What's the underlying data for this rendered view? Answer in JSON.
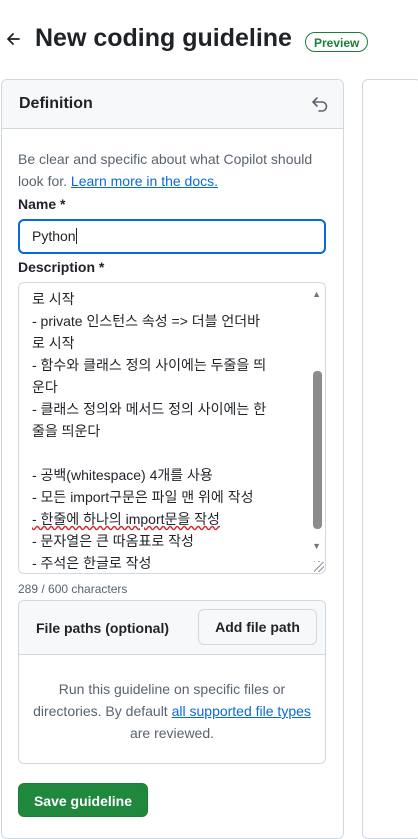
{
  "header": {
    "title": "New coding guideline",
    "badge": "Preview"
  },
  "definition": {
    "title": "Definition",
    "intro_text": "Be clear and specific about what Copilot should look for. ",
    "intro_link": "Learn more in the docs.",
    "name_label": "Name *",
    "name_value": "Python",
    "description_label": "Description *",
    "description_lines": [
      "로 시작",
      "- private 인스턴스 속성 => 더블 언더바",
      "로 시작",
      "- 함수와 클래스 정의 사이에는 두줄을 띄",
      "운다",
      "- 클래스 정의와 메서드 정의 사이에는 한",
      "줄을 띄운다",
      "",
      "- 공백(whitespace) 4개를 사용",
      "- 모든 import구문은 파일 맨 위에 작성",
      "- 한줄에 하나의 import문을 작성",
      "- 문자열은 큰 따옴표로 작성",
      "- 주석은 한글로 작성"
    ],
    "char_count": "289 / 600 characters"
  },
  "file_paths": {
    "title": "File paths (optional)",
    "add_button": "Add file path",
    "body_text_1": "Run this guideline on specific files or directories. By default ",
    "body_link": "all supported file types",
    "body_text_2": " are reviewed."
  },
  "actions": {
    "save_button": "Save guideline"
  }
}
